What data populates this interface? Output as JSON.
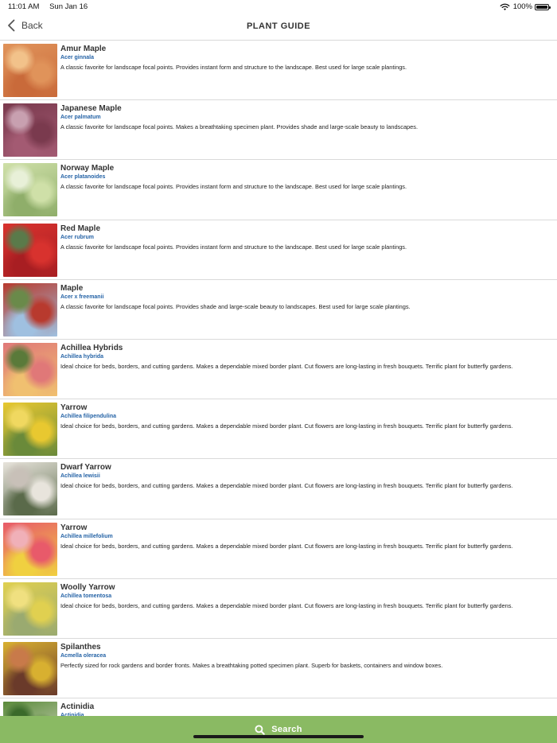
{
  "status_bar": {
    "time": "11:01 AM",
    "date": "Sun Jan 16",
    "battery": "100%"
  },
  "nav": {
    "back_label": "Back",
    "title": "PLANT GUIDE"
  },
  "plants": [
    {
      "name": "Amur Maple",
      "latin": "Acer ginnala",
      "desc": "A classic favorite for landscape focal points. Provides instant form and structure to the landscape. Best used for large scale plantings.",
      "colors": [
        "#e0935a",
        "#c96a3a",
        "#f2c28a"
      ]
    },
    {
      "name": "Japanese Maple",
      "latin": "Acer palmatum",
      "desc": "A classic favorite for landscape focal points. Makes a breathtaking specimen plant. Provides shade and large-scale beauty to landscapes.",
      "colors": [
        "#7a3a4e",
        "#a35a72",
        "#c8a0b0"
      ]
    },
    {
      "name": "Norway Maple",
      "latin": "Acer platanoides",
      "desc": "A classic favorite for landscape focal points. Provides instant form and structure to the landscape. Best used for large scale plantings.",
      "colors": [
        "#cfe0a8",
        "#8fae6a",
        "#e8f0d8"
      ]
    },
    {
      "name": "Red Maple",
      "latin": "Acer rubrum",
      "desc": "A classic favorite for landscape focal points. Provides instant form and structure to the landscape. Best used for large scale plantings.",
      "colors": [
        "#d8322e",
        "#a81e22",
        "#5a7a4a"
      ]
    },
    {
      "name": "Maple",
      "latin": "Acer x freemanii",
      "desc": "A classic favorite for landscape focal points. Provides shade and large-scale beauty to landscapes. Best used for large scale plantings.",
      "colors": [
        "#b83a2e",
        "#9fc0e0",
        "#6a8a4a"
      ]
    },
    {
      "name": "Achillea Hybrids",
      "latin": "Achillea hybrida",
      "desc": "Ideal choice for beds, borders, and cutting gardens. Makes a dependable mixed border plant. Cut flowers are long-lasting in fresh bouquets. Terrific plant for butterfly gardens.",
      "colors": [
        "#e07878",
        "#f0c070",
        "#5a7a3a"
      ]
    },
    {
      "name": "Yarrow",
      "latin": "Achillea filipendulina",
      "desc": "Ideal choice for beds, borders, and cutting gardens. Makes a dependable mixed border plant. Cut flowers are long-lasting in fresh bouquets. Terrific plant for butterfly gardens.",
      "colors": [
        "#e8c830",
        "#6a8a3a",
        "#f0d860"
      ]
    },
    {
      "name": "Dwarf Yarrow",
      "latin": "Achillea lewisii",
      "desc": "Ideal choice for beds, borders, and cutting gardens. Makes a dependable mixed border plant. Cut flowers are long-lasting in fresh bouquets. Terrific plant for butterfly gardens.",
      "colors": [
        "#e8e4dc",
        "#5a6a4a",
        "#c8c0b8"
      ]
    },
    {
      "name": "Yarrow",
      "latin": "Achillea millefolium",
      "desc": "Ideal choice for beds, borders, and cutting gardens. Makes a dependable mixed border plant. Cut flowers are long-lasting in fresh bouquets. Terrific plant for butterfly gardens.",
      "colors": [
        "#e85a6a",
        "#f0d040",
        "#f0b0b8"
      ]
    },
    {
      "name": "Woolly Yarrow",
      "latin": "Achillea tomentosa",
      "desc": "Ideal choice for beds, borders, and cutting gardens. Makes a dependable mixed border plant. Cut flowers are long-lasting in fresh bouquets. Terrific plant for butterfly gardens.",
      "colors": [
        "#e0d050",
        "#9aaa70",
        "#f0e080"
      ]
    },
    {
      "name": "Spilanthes",
      "latin": "Acmella oleracea",
      "desc": "Perfectly sized for rock gardens and border fronts. Makes a breathtaking potted specimen plant. Superb for baskets, containers and window boxes.",
      "colors": [
        "#d8b030",
        "#6a3a2a",
        "#c87a4a"
      ]
    },
    {
      "name": "Actinidia",
      "latin": "Actinidia",
      "desc": "",
      "colors": [
        "#5a8a3a",
        "#e0e0d0",
        "#3a6a2a"
      ]
    }
  ],
  "search": {
    "label": "Search"
  }
}
